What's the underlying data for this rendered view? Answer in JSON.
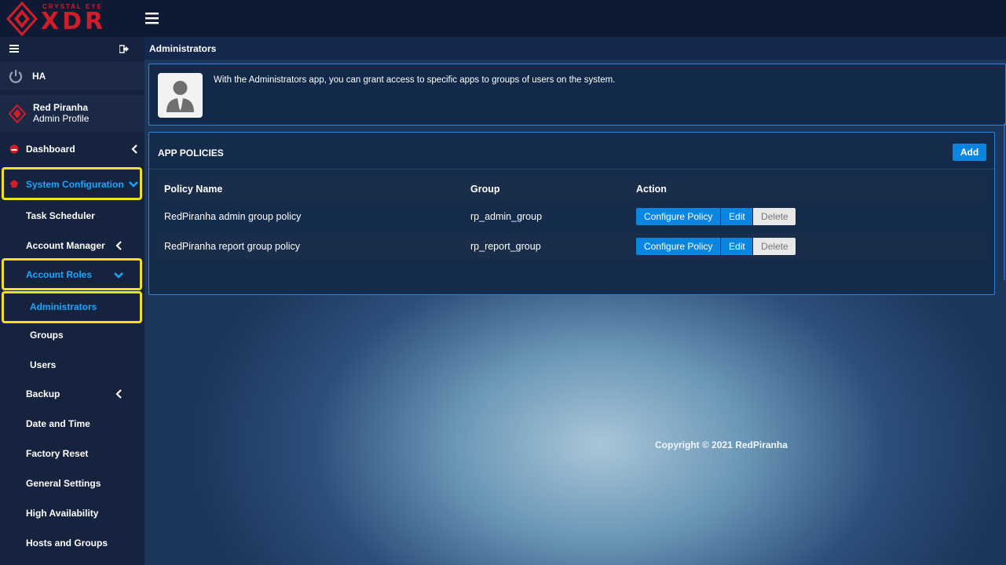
{
  "brand": {
    "top": "CRYSTAL EYE",
    "main": "XDR"
  },
  "sidebar": {
    "ha_label": "HA",
    "profile": {
      "name": "Red Piranha",
      "role": "Admin Profile"
    },
    "items": [
      {
        "label": "Dashboard"
      },
      {
        "label": "System Configuration"
      },
      {
        "label": "Task Scheduler"
      },
      {
        "label": "Account Manager"
      },
      {
        "label": "Account Roles"
      },
      {
        "label": "Administrators"
      },
      {
        "label": "Groups"
      },
      {
        "label": "Users"
      },
      {
        "label": "Backup"
      },
      {
        "label": "Date and Time"
      },
      {
        "label": "Factory Reset"
      },
      {
        "label": "General Settings"
      },
      {
        "label": "High Availability"
      },
      {
        "label": "Hosts and Groups"
      }
    ]
  },
  "main": {
    "title": "Administrators",
    "info_text": "With the Administrators app, you can grant access to specific apps to groups of users on the system.",
    "panel_title": "APP POLICIES",
    "add_label": "Add",
    "columns": [
      "Policy Name",
      "Group",
      "Action"
    ],
    "rows": [
      {
        "policy": "RedPiranha admin group policy",
        "group": "rp_admin_group"
      },
      {
        "policy": "RedPiranha report group policy",
        "group": "rp_report_group"
      }
    ],
    "actions": {
      "configure": "Configure Policy",
      "edit": "Edit",
      "delete": "Delete"
    },
    "copyright": "Copyright © 2021 RedPiranha"
  },
  "colors": {
    "accent": "#1aa6ff",
    "button": "#0b86e0",
    "highlight": "#f2e21d",
    "brand": "#d11d2a"
  }
}
